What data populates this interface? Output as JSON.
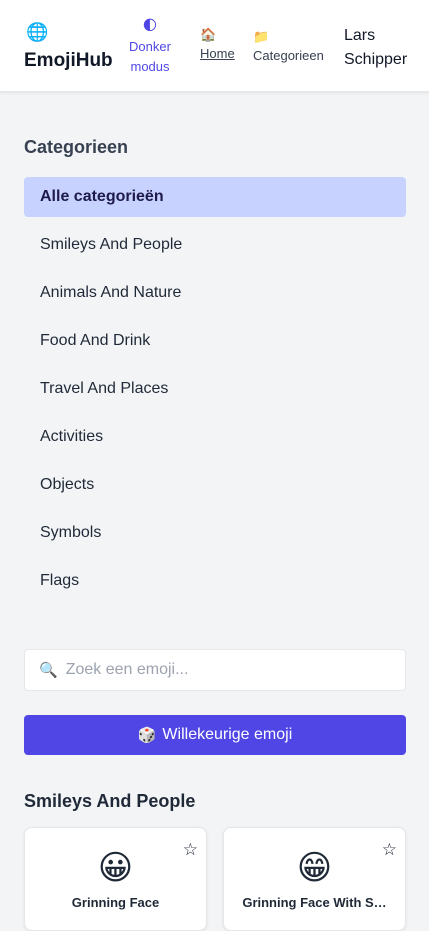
{
  "header": {
    "logo_icon": "🌐",
    "app_title": "EmojiHub",
    "dark_mode_icon": "🌓",
    "dark_mode_label": "Donker modus",
    "nav_home_icon": "🏠",
    "nav_home_label": "Home",
    "nav_categories_icon": "📁",
    "nav_categories_label": "Categorieen",
    "user_name": "Lars Schipper"
  },
  "sidebar": {
    "heading": "Categorieen",
    "items": [
      {
        "label": "Alle categorieën",
        "active": true
      },
      {
        "label": "Smileys And People"
      },
      {
        "label": "Animals And Nature"
      },
      {
        "label": "Food And Drink"
      },
      {
        "label": "Travel And Places"
      },
      {
        "label": "Activities"
      },
      {
        "label": "Objects"
      },
      {
        "label": "Symbols"
      },
      {
        "label": "Flags"
      }
    ]
  },
  "search": {
    "icon": "🔍",
    "placeholder": "Zoek een emoji...",
    "value": ""
  },
  "random_button": {
    "icon": "🎲",
    "label": "Willekeurige emoji"
  },
  "section": {
    "title": "Smileys And People",
    "cards": [
      {
        "emoji": "😀",
        "name": "Grinning Face",
        "favorite_icon": "☆"
      },
      {
        "emoji": "😁",
        "name": "Grinning Face With S…",
        "favorite_icon": "☆"
      }
    ]
  },
  "colors": {
    "accent": "#4f46e5",
    "active_category_bg": "#c7d2fe",
    "page_bg": "#f3f4f6"
  }
}
